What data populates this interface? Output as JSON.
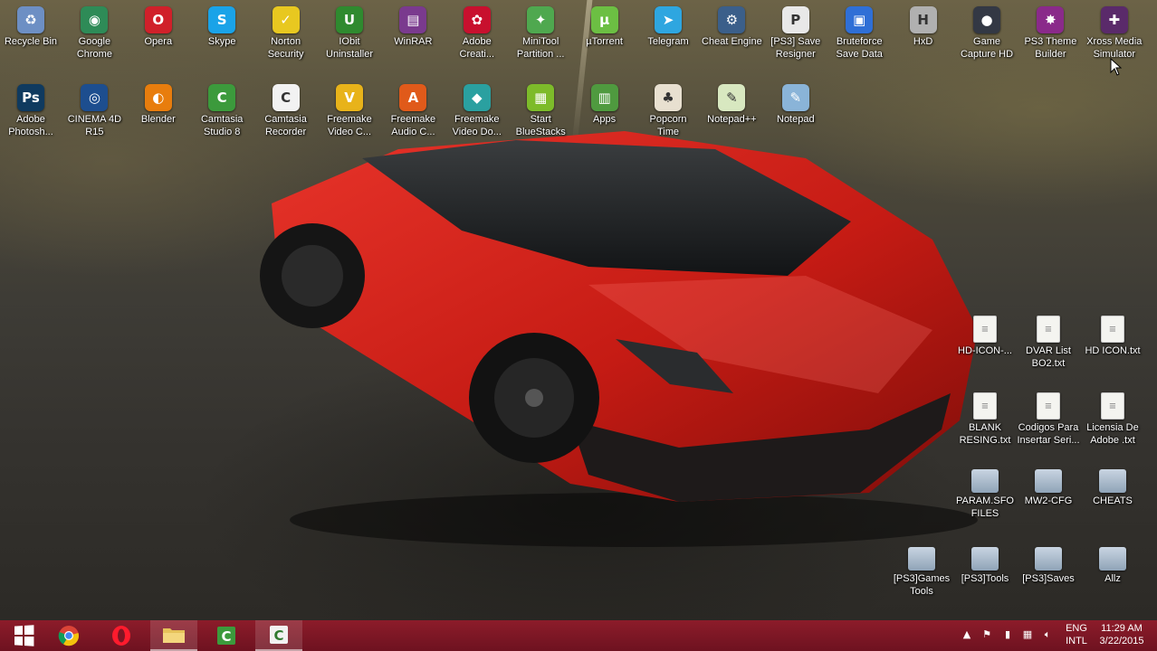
{
  "desktop": {
    "row1": [
      {
        "label": "Recycle Bin",
        "icon": "recycle-bin-icon",
        "color": "#6d8fc4",
        "glyph": "♻"
      },
      {
        "label": "Google\nChrome",
        "icon": "chrome-icon",
        "color": "#2e8b57",
        "glyph": "◉"
      },
      {
        "label": "Opera",
        "icon": "opera-icon",
        "color": "#d0202a",
        "glyph": "O"
      },
      {
        "label": "Skype",
        "icon": "skype-icon",
        "color": "#1aa3e8",
        "glyph": "S"
      },
      {
        "label": "Norton\nSecurity",
        "icon": "norton-icon",
        "color": "#e8c820",
        "glyph": "✓"
      },
      {
        "label": "IObit\nUninstaller",
        "icon": "iobit-icon",
        "color": "#2f8a2f",
        "glyph": "U"
      },
      {
        "label": "WinRAR",
        "icon": "winrar-icon",
        "color": "#7a3a8e",
        "glyph": "▤"
      },
      {
        "label": "Adobe\nCreati...",
        "icon": "adobe-cc-icon",
        "color": "#c8102e",
        "glyph": "✿"
      },
      {
        "label": "MiniTool\nPartition ...",
        "icon": "minitool-icon",
        "color": "#4fa84f",
        "glyph": "✦"
      },
      {
        "label": "µTorrent",
        "icon": "utorrent-icon",
        "color": "#6cbf43",
        "glyph": "µ"
      },
      {
        "label": "Telegram",
        "icon": "telegram-icon",
        "color": "#2ea6e0",
        "glyph": "➤"
      },
      {
        "label": "Cheat Engine",
        "icon": "cheat-engine-icon",
        "color": "#3b5f8a",
        "glyph": "⚙"
      },
      {
        "label": "[PS3] Save\nResigner",
        "icon": "ps3-save-resigner-icon",
        "color": "#e8e8e8",
        "glyph": "P"
      },
      {
        "label": "Bruteforce\nSave Data",
        "icon": "bruteforce-icon",
        "color": "#2f6fd6",
        "glyph": "▣"
      },
      {
        "label": "HxD",
        "icon": "hxd-icon",
        "color": "#b0b0b0",
        "glyph": "H"
      },
      {
        "label": "Game\nCapture HD",
        "icon": "game-capture-icon",
        "color": "#333844",
        "glyph": "●"
      },
      {
        "label": "PS3 Theme\nBuilder",
        "icon": "ps3-theme-builder-icon",
        "color": "#8a2a8a",
        "glyph": "✸"
      },
      {
        "label": "Xross Media\nSimulator",
        "icon": "xross-media-icon",
        "color": "#5a2a6a",
        "glyph": "✚"
      }
    ],
    "row2": [
      {
        "label": "Adobe\nPhotosh...",
        "icon": "photoshop-icon",
        "color": "#0f3a5f",
        "glyph": "Ps"
      },
      {
        "label": "CINEMA 4D\nR15",
        "icon": "cinema4d-icon",
        "color": "#1d4e8f",
        "glyph": "◎"
      },
      {
        "label": "Blender",
        "icon": "blender-icon",
        "color": "#e87d0d",
        "glyph": "◐"
      },
      {
        "label": "Camtasia\nStudio 8",
        "icon": "camtasia-studio-icon",
        "color": "#3c9a3c",
        "glyph": "C"
      },
      {
        "label": "Camtasia\nRecorder",
        "icon": "camtasia-recorder-icon",
        "color": "#f2f2f2",
        "glyph": "C"
      },
      {
        "label": "Freemake\nVideo C...",
        "icon": "freemake-video-converter-icon",
        "color": "#e8b31a",
        "glyph": "V"
      },
      {
        "label": "Freemake\nAudio C...",
        "icon": "freemake-audio-converter-icon",
        "color": "#e05a1a",
        "glyph": "A"
      },
      {
        "label": "Freemake\nVideo Do...",
        "icon": "freemake-video-downloader-icon",
        "color": "#2aa0a0",
        "glyph": "◆"
      },
      {
        "label": "Start\nBlueStacks",
        "icon": "bluestacks-icon",
        "color": "#7dbb2a",
        "glyph": "▦"
      },
      {
        "label": "Apps",
        "icon": "apps-icon",
        "color": "#4f9a3f",
        "glyph": "▥"
      },
      {
        "label": "Popcorn\nTime",
        "icon": "popcorn-time-icon",
        "color": "#e8e0d0",
        "glyph": "♣"
      },
      {
        "label": "Notepad++",
        "icon": "notepadpp-icon",
        "color": "#d8e8c0",
        "glyph": "✎"
      },
      {
        "label": "Notepad",
        "icon": "notepad-icon",
        "color": "#8ab4d8",
        "glyph": "✎"
      }
    ],
    "files": [
      {
        "label": "HD-ICON-...",
        "icon": "text-file-icon",
        "kind": "doc"
      },
      {
        "label": "DVAR List\nBO2.txt",
        "icon": "text-file-icon",
        "kind": "doc"
      },
      {
        "label": "HD ICON.txt",
        "icon": "text-file-icon",
        "kind": "doc"
      },
      {
        "label": "BLANK\nRESING.txt",
        "icon": "text-file-icon",
        "kind": "doc"
      },
      {
        "label": "Codigos Para\nInsertar Seri...",
        "icon": "text-file-icon",
        "kind": "doc"
      },
      {
        "label": "Licensia De\nAdobe .txt",
        "icon": "text-file-icon",
        "kind": "doc"
      },
      {
        "label": "PARAM.SFO\nFILES",
        "icon": "folder-icon",
        "kind": "folder"
      },
      {
        "label": "MW2-CFG",
        "icon": "folder-icon",
        "kind": "folder"
      },
      {
        "label": "CHEATS",
        "icon": "folder-icon",
        "kind": "folder"
      },
      {
        "label": "[PS3]Games\nTools",
        "icon": "folder-icon",
        "kind": "folder"
      },
      {
        "label": "[PS3]Tools",
        "icon": "folder-icon",
        "kind": "folder"
      },
      {
        "label": "[PS3]Saves",
        "icon": "folder-icon",
        "kind": "folder"
      },
      {
        "label": "Allz",
        "icon": "folder-icon",
        "kind": "folder"
      }
    ]
  },
  "taskbar": {
    "apps": [
      "start-button",
      "chrome",
      "opera",
      "file-explorer",
      "camtasia-studio",
      "camtasia-recorder"
    ],
    "language": "ENG",
    "layout": "INTL",
    "time": "11:29 AM",
    "date": "3/22/2015",
    "color": "#7d1624"
  }
}
